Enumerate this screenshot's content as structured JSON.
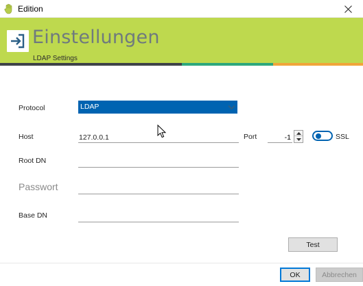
{
  "window": {
    "title": "Edition",
    "app_icon": "hand-icon",
    "close_icon": "close-icon"
  },
  "banner": {
    "title": "Einstellungen",
    "subtitle": "LDAP Settings",
    "icon": "sign-in-icon",
    "colors": {
      "banner": "#bed94e",
      "stripe_dark": "#3e4247",
      "stripe_green": "#2da87c",
      "stripe_orange": "#f0a53a"
    }
  },
  "form": {
    "protocol": {
      "label": "Protocol",
      "value": "LDAP"
    },
    "host": {
      "label": "Host",
      "value": "127.0.0.1"
    },
    "port": {
      "label": "Port",
      "value": "-1"
    },
    "ssl": {
      "label": "SSL",
      "checked": true
    },
    "root_dn": {
      "label": "Root DN",
      "value": ""
    },
    "passwort": {
      "label": "Passwort",
      "value": ""
    },
    "base_dn": {
      "label": "Base DN",
      "value": ""
    }
  },
  "buttons": {
    "test": "Test",
    "ok": "OK",
    "cancel": "Abbrechen"
  },
  "accent_color": "#0063b1"
}
